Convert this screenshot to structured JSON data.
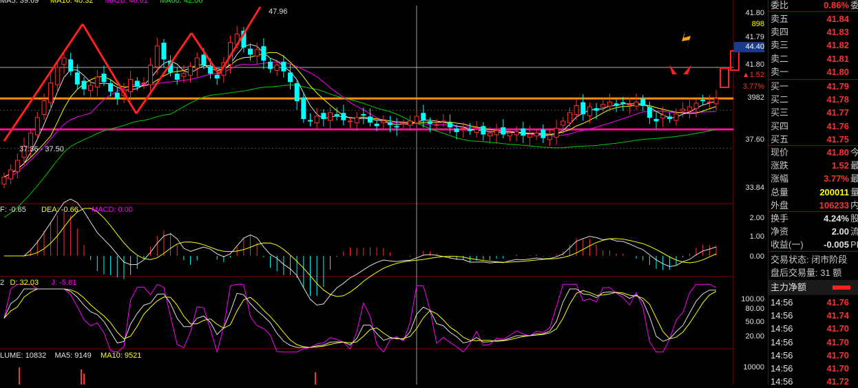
{
  "main_panel": {
    "ma_header": [
      {
        "text": "MA5: 39.69",
        "color": "#e0e0e0"
      },
      {
        "text": "MA10: 40.32",
        "color": "#ffff00"
      },
      {
        "text": "MA20: 40.61",
        "color": "#ff00ff"
      },
      {
        "text": "MA60: 42.06",
        "color": "#00ff00"
      }
    ],
    "peak_label": "47.96",
    "low_label": "37.36 - 37.50",
    "axis_labels": [
      "41.80",
      "898",
      "41.79",
      "44.40",
      "41.80",
      "▲1.52",
      "3.77%",
      "3982",
      "37.60",
      "33.84"
    ],
    "axis_label_colors": [
      "#e0e0e0",
      "#ffff00",
      "#e0e0e0",
      "#ffffff",
      "#e0e0e0",
      "#ff3030",
      "#ff3030",
      "#e0e0e0",
      "#e0e0e0",
      "#e0e0e0"
    ]
  },
  "macd_panel": {
    "header": [
      {
        "text": "F: -0.65",
        "color": "#e0e0e0"
      },
      {
        "text": "DEA: -0.66",
        "color": "#ffff00"
      },
      {
        "text": "MACD: 0.00",
        "color": "#ff00ff"
      }
    ],
    "axis_labels": [
      "2.00",
      "1.00",
      "0.00"
    ]
  },
  "kdj_panel": {
    "header": [
      {
        "text": "2",
        "color": "#e0e0e0"
      },
      {
        "text": "D: 32.03",
        "color": "#ffff00"
      },
      {
        "text": "J: -5.81",
        "color": "#ff00ff"
      }
    ],
    "axis_labels": [
      "100.00",
      "80.00",
      "50.00",
      "20.00"
    ]
  },
  "volume_panel": {
    "header": [
      {
        "text": "LUME: 10832",
        "color": "#e0e0e0"
      },
      {
        "text": "MA5: 9149",
        "color": "#e0e0e0"
      },
      {
        "text": "MA10: 9521",
        "color": "#ffff00"
      }
    ],
    "axis_labels": [
      "10000"
    ]
  },
  "quote": {
    "top": {
      "label": "委比",
      "value": "0.86%",
      "tail": "委"
    },
    "asks": [
      {
        "label": "卖五",
        "price": "41.84"
      },
      {
        "label": "卖四",
        "price": "41.83"
      },
      {
        "label": "卖三",
        "price": "41.82"
      },
      {
        "label": "卖二",
        "price": "41.81"
      },
      {
        "label": "卖一",
        "price": "41.80"
      }
    ],
    "bids": [
      {
        "label": "买一",
        "price": "41.79"
      },
      {
        "label": "买二",
        "price": "41.78"
      },
      {
        "label": "买三",
        "price": "41.77"
      },
      {
        "label": "买四",
        "price": "41.76"
      },
      {
        "label": "买五",
        "price": "41.75"
      }
    ],
    "stats": [
      {
        "label": "现价",
        "value": "41.80",
        "tail": "今",
        "color": "red"
      },
      {
        "label": "涨跌",
        "value": "1.52",
        "tail": "最",
        "color": "red"
      },
      {
        "label": "涨幅",
        "value": "3.77%",
        "tail": "最",
        "color": "red"
      },
      {
        "label": "总量",
        "value": "200011",
        "tail": "量",
        "color": "yel"
      },
      {
        "label": "外盘",
        "value": "106233",
        "tail": "内",
        "color": "red"
      }
    ],
    "stats2": [
      {
        "label": "换手",
        "value": "4.24%",
        "tail": "股",
        "color": "wht"
      },
      {
        "label": "净资",
        "value": "2.00",
        "tail": "流",
        "color": "wht"
      },
      {
        "label": "收益(一)",
        "value": "-0.005",
        "tail": "PE",
        "color": "wht"
      }
    ],
    "status_line": "交易状态: 闭市阶段",
    "after_hours": "盘后交易量: 31 额",
    "main_flow_title": "主力净额",
    "ticks": [
      {
        "time": "14:56",
        "price": "41.76"
      },
      {
        "time": "14:56",
        "price": "41.74"
      },
      {
        "time": "14:56",
        "price": "41.70"
      },
      {
        "time": "14:56",
        "price": "41.70"
      },
      {
        "time": "14:56",
        "price": "41.70"
      },
      {
        "time": "14:56",
        "price": "41.70"
      },
      {
        "time": "14:56",
        "price": "41.72"
      }
    ]
  },
  "chart_data": {
    "type": "candlestick",
    "price_range": [
      33.2,
      49.6
    ],
    "key_prices": {
      "high": 47.96,
      "low_marker": 37.36,
      "current": 41.8,
      "resistance": 44.4,
      "support": 39.2
    },
    "horizontal_lines": [
      {
        "price": 41.8,
        "color": "#ff8c00",
        "label": "orange"
      },
      {
        "price": 39.2,
        "color": "#ff1493",
        "label": "magenta"
      },
      {
        "price": 44.4,
        "color": "#b0b0b0",
        "label": "grey"
      }
    ],
    "closes": [
      35.2,
      35.8,
      36.6,
      37.8,
      38.9,
      40.2,
      41.6,
      43.1,
      44.4,
      45.2,
      44.1,
      43.0,
      42.6,
      42.9,
      43.6,
      43.2,
      42.4,
      41.8,
      42.5,
      43.4,
      42.8,
      43.1,
      44.6,
      46.2,
      45.1,
      44.0,
      43.4,
      43.9,
      44.5,
      45.2,
      44.6,
      43.9,
      43.5,
      44.8,
      46.5,
      47.2,
      46.1,
      45.5,
      45.9,
      45.0,
      44.3,
      44.6,
      44.1,
      43.2,
      41.6,
      40.1,
      39.9,
      40.3,
      40.1,
      40.6,
      40.3,
      40.0,
      39.9,
      40.2,
      40.4,
      39.8,
      39.5,
      39.9,
      39.6,
      39.4,
      39.7,
      39.9,
      40.3,
      40.0,
      39.7,
      39.6,
      39.9,
      39.4,
      39.0,
      39.3,
      39.1,
      39.2,
      38.8,
      38.9,
      39.1,
      38.8,
      38.9,
      39.0,
      38.7,
      38.8,
      38.9,
      38.5,
      38.7,
      39.3,
      39.9,
      40.6,
      41.2,
      40.5,
      41.1,
      40.8,
      41.3,
      41.5,
      41.2,
      41.4,
      41.3,
      41.5,
      41.2,
      40.2,
      39.9,
      40.4,
      40.1,
      40.5,
      40.9,
      41.1,
      41.4,
      41.6,
      41.5,
      41.8
    ]
  }
}
